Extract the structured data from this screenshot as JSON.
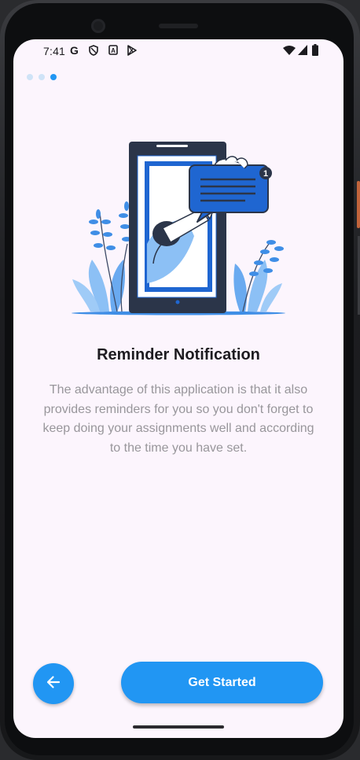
{
  "status_bar": {
    "time": "7:41",
    "left_icons": [
      "google-g-icon",
      "shield-icon",
      "a-box-icon",
      "play-store-icon"
    ],
    "right_icons": [
      "wifi-icon",
      "signal-icon",
      "battery-icon"
    ],
    "g_glyph": "G",
    "a_glyph": "A"
  },
  "pager": {
    "total": 3,
    "current": 3,
    "active_color": "#2196f3",
    "inactive_color": "#cfe3f7"
  },
  "content": {
    "title": "Reminder Notification",
    "description": "The advantage of this application is that it also provides reminders for you so you don't forget to keep doing your assignments well and according to the time you have set.",
    "badge_count": "1"
  },
  "actions": {
    "back_icon": "arrow-left-icon",
    "start_label": "Get Started"
  },
  "colors": {
    "accent": "#2196f3",
    "background": "#fcf5fd",
    "title": "#1d1b20",
    "description": "#98969b"
  }
}
